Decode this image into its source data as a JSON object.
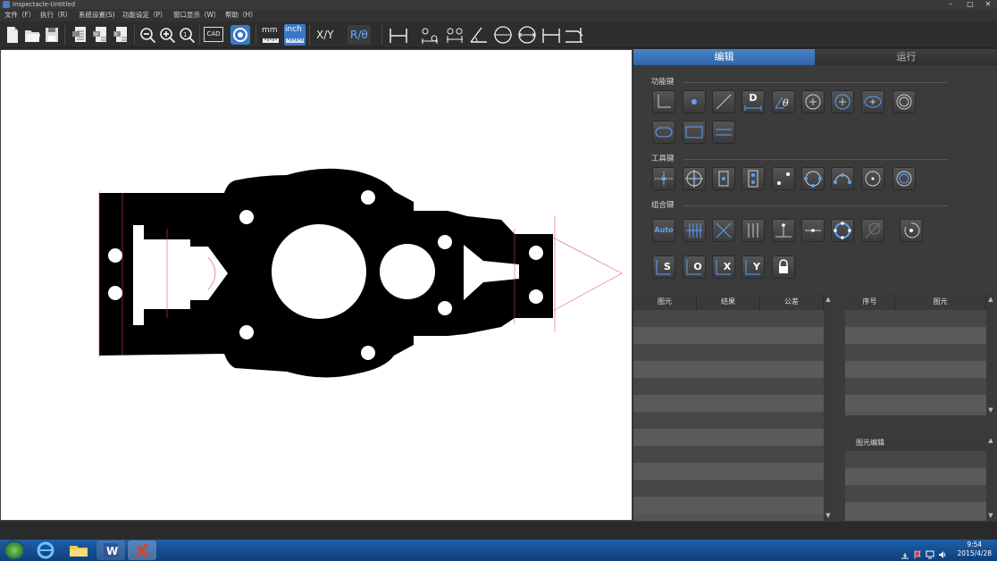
{
  "window": {
    "title": "Inspectacle-Untitled",
    "min": "–",
    "max": "□",
    "close": "✕"
  },
  "menu": [
    {
      "label": "文件（F）"
    },
    {
      "label": "执行（R）"
    },
    {
      "label": "系统设置(S)"
    },
    {
      "label": "功能设定（P）"
    },
    {
      "label": "窗口显示（W）"
    },
    {
      "label": "帮助（H）"
    }
  ],
  "toolbar": {
    "cad": "CAD",
    "mm": "mm",
    "inch": "inch",
    "xy": "X/Y",
    "rtheta": "R/θ"
  },
  "tabs": {
    "edit": "编辑",
    "run": "运行"
  },
  "sections": {
    "function_keys": "功能键",
    "tool_keys": "工具键",
    "combo_keys": "组合键"
  },
  "buttons": {
    "distance": "D",
    "auto": "Auto",
    "s": "S",
    "o": "O",
    "x": "X",
    "y": "Y"
  },
  "result_table": {
    "columns": [
      "图元",
      "结果",
      "公差"
    ]
  },
  "element_table": {
    "columns": [
      "序号",
      "图元"
    ]
  },
  "element_edit": {
    "title": "图元编辑"
  },
  "clock": {
    "time": "9:54",
    "date": "2015/4/28"
  },
  "colors": {
    "accent": "#3a78c6",
    "icon_blue": "#5aa0ff",
    "panel": "#3b3b3b"
  }
}
